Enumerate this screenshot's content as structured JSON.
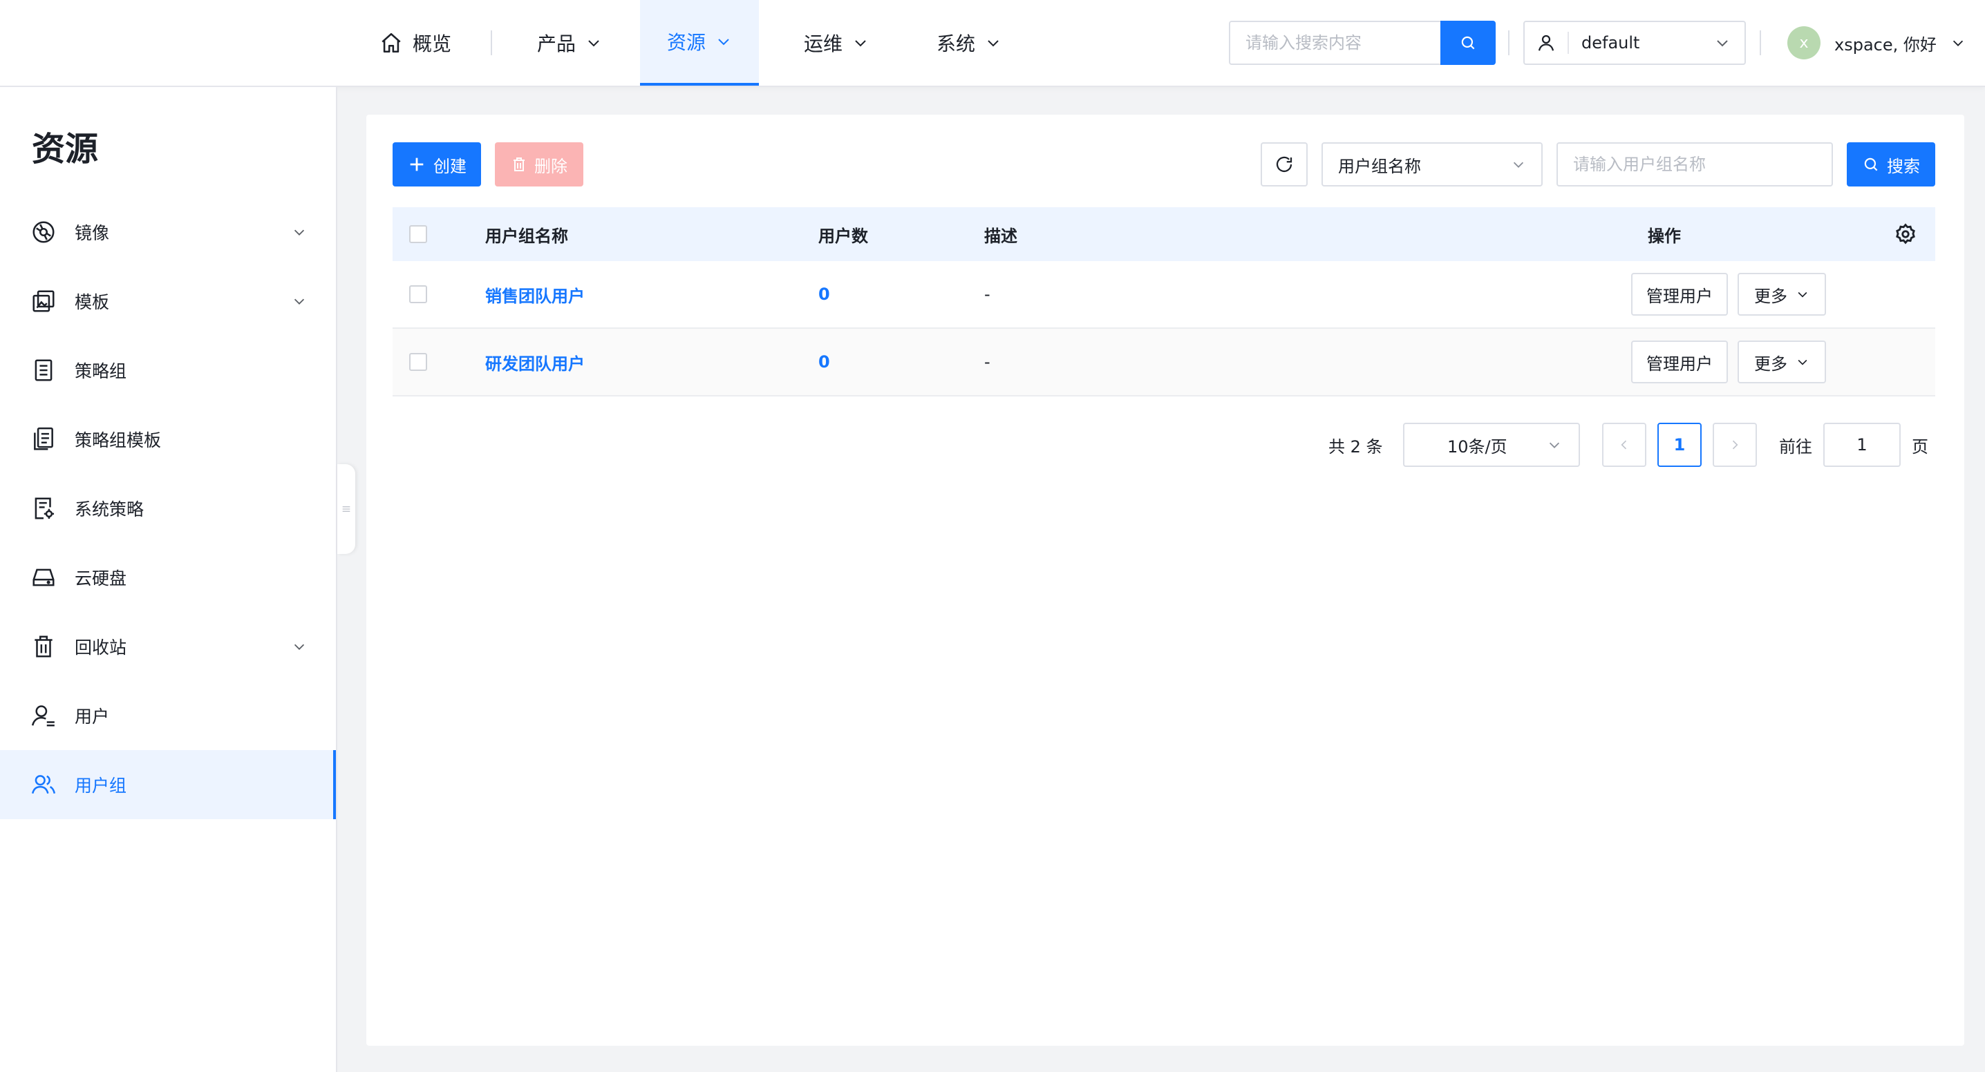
{
  "nav": {
    "items": [
      {
        "label": "概览",
        "icon": "home-icon",
        "active": false
      },
      {
        "label": "产品",
        "icon": "chevron-down-icon",
        "active": false
      },
      {
        "label": "资源",
        "icon": "chevron-down-icon",
        "active": true
      },
      {
        "label": "运维",
        "icon": "chevron-down-icon",
        "active": false
      },
      {
        "label": "系统",
        "icon": "chevron-down-icon",
        "active": false
      }
    ],
    "search_placeholder": "请输入搜索内容",
    "workspace": "default",
    "user_initial": "x",
    "user_greeting": "xspace, 你好"
  },
  "sidebar": {
    "title": "资源",
    "items": [
      {
        "label": "镜像",
        "icon": "image-disc-icon",
        "expandable": true
      },
      {
        "label": "模板",
        "icon": "template-icon",
        "expandable": true
      },
      {
        "label": "策略组",
        "icon": "document-icon",
        "expandable": false
      },
      {
        "label": "策略组模板",
        "icon": "documents-icon",
        "expandable": false
      },
      {
        "label": "系统策略",
        "icon": "document-gear-icon",
        "expandable": false
      },
      {
        "label": "云硬盘",
        "icon": "disk-icon",
        "expandable": false
      },
      {
        "label": "回收站",
        "icon": "trash-icon",
        "expandable": true
      },
      {
        "label": "用户",
        "icon": "user-icon",
        "expandable": false
      },
      {
        "label": "用户组",
        "icon": "users-icon",
        "expandable": false,
        "active": true
      }
    ]
  },
  "toolbar": {
    "create_label": "创建",
    "delete_label": "删除",
    "filter_field": "用户组名称",
    "filter_placeholder": "请输入用户组名称",
    "search_label": "搜索"
  },
  "table": {
    "columns": [
      "用户组名称",
      "用户数",
      "描述",
      "操作"
    ],
    "rows": [
      {
        "name": "销售团队用户",
        "count": "0",
        "desc": "-",
        "manage": "管理用户",
        "more": "更多"
      },
      {
        "name": "研发团队用户",
        "count": "0",
        "desc": "-",
        "manage": "管理用户",
        "more": "更多"
      }
    ]
  },
  "pagination": {
    "total": "共 2 条",
    "page_size": "10条/页",
    "current_page": "1",
    "goto_label": "前往",
    "goto_value": "1",
    "goto_suffix": "页"
  },
  "colors": {
    "accent": "#1677ff",
    "delete_disabled": "#fbb4b4",
    "header_bg": "#edf4ff"
  }
}
